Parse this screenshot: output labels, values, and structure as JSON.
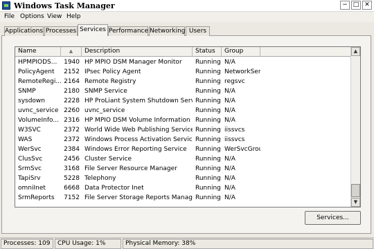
{
  "window": {
    "title": "Windows Task Manager",
    "btn_minimize": "−",
    "btn_maximize": "□",
    "btn_close": "✕"
  },
  "menu": {
    "items": [
      "File",
      "Options",
      "View",
      "Help"
    ]
  },
  "tabs": [
    {
      "label": "Applications"
    },
    {
      "label": "Processes"
    },
    {
      "label": "Services",
      "active": true
    },
    {
      "label": "Performance"
    },
    {
      "label": "Networking"
    },
    {
      "label": "Users"
    }
  ],
  "list": {
    "columns": {
      "name": "Name",
      "pid_sort_arrow": "▲",
      "description": "Description",
      "status": "Status",
      "group": "Group"
    },
    "rows": [
      {
        "name": "HPMPIODS...",
        "pid": "1940",
        "description": "HP MPIO DSM Manager Monitor",
        "status": "Running",
        "group": "N/A"
      },
      {
        "name": "PolicyAgent",
        "pid": "2152",
        "description": "IPsec Policy Agent",
        "status": "Running",
        "group": "NetworkSer..."
      },
      {
        "name": "RemoteRegi...",
        "pid": "2164",
        "description": "Remote Registry",
        "status": "Running",
        "group": "regsvc"
      },
      {
        "name": "SNMP",
        "pid": "2180",
        "description": "SNMP Service",
        "status": "Running",
        "group": "N/A"
      },
      {
        "name": "sysdown",
        "pid": "2228",
        "description": "HP ProLiant System Shutdown Service",
        "status": "Running",
        "group": "N/A"
      },
      {
        "name": "uvnc_service",
        "pid": "2260",
        "description": "uvnc_service",
        "status": "Running",
        "group": "N/A"
      },
      {
        "name": "VolumeInfo...",
        "pid": "2316",
        "description": "HP MPIO DSM Volume Information ...",
        "status": "Running",
        "group": "N/A"
      },
      {
        "name": "W3SVC",
        "pid": "2372",
        "description": "World Wide Web Publishing Service",
        "status": "Running",
        "group": "iissvcs"
      },
      {
        "name": "WAS",
        "pid": "2372",
        "description": "Windows Process Activation Service",
        "status": "Running",
        "group": "iissvcs"
      },
      {
        "name": "WerSvc",
        "pid": "2384",
        "description": "Windows Error Reporting Service",
        "status": "Running",
        "group": "WerSvcGroup"
      },
      {
        "name": "ClusSvc",
        "pid": "2456",
        "description": "Cluster Service",
        "status": "Running",
        "group": "N/A"
      },
      {
        "name": "SrmSvc",
        "pid": "3168",
        "description": "File Server Resource Manager",
        "status": "Running",
        "group": "N/A"
      },
      {
        "name": "TapiSrv",
        "pid": "5228",
        "description": "Telephony",
        "status": "Running",
        "group": "N/A"
      },
      {
        "name": "omniInet",
        "pid": "6668",
        "description": "Data Protector Inet",
        "status": "Running",
        "group": "N/A"
      },
      {
        "name": "SrmReports",
        "pid": "7152",
        "description": "File Server Storage Reports Manager",
        "status": "Running",
        "group": "N/A"
      }
    ],
    "scroll_up": "▲",
    "scroll_down": "▼"
  },
  "services_button": "Services...",
  "statusbar": {
    "processes": "Processes: 109",
    "cpu": "CPU Usage: 1%",
    "memory": "Physical Memory: 38%"
  }
}
